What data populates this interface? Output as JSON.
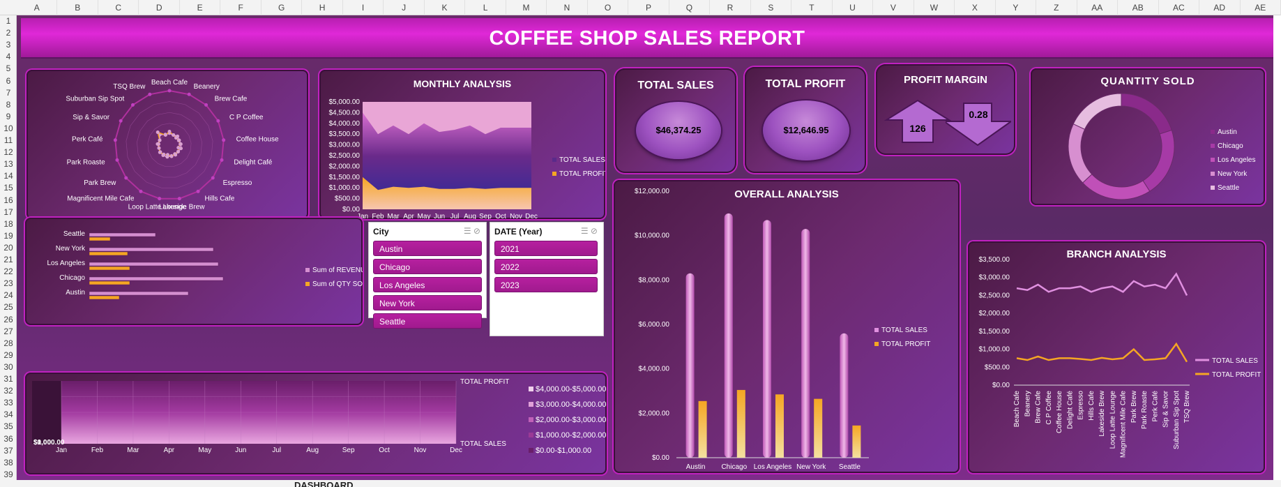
{
  "sheet": {
    "columns": [
      "A",
      "B",
      "C",
      "D",
      "E",
      "F",
      "G",
      "H",
      "I",
      "J",
      "K",
      "L",
      "M",
      "N",
      "O",
      "P",
      "Q",
      "R",
      "S",
      "T",
      "U",
      "V",
      "W",
      "X",
      "Y",
      "Z",
      "AA",
      "AB",
      "AC",
      "AD",
      "AE"
    ],
    "rows": [
      "1",
      "2",
      "3",
      "4",
      "5",
      "6",
      "7",
      "8",
      "9",
      "10",
      "11",
      "12",
      "13",
      "14",
      "15",
      "16",
      "17",
      "18",
      "19",
      "20",
      "21",
      "22",
      "23",
      "24",
      "25",
      "26",
      "27",
      "28",
      "29",
      "30",
      "31",
      "32",
      "33",
      "34",
      "35",
      "36",
      "37",
      "38",
      "39"
    ],
    "active_tab": "DASHBOARD"
  },
  "dashboard": {
    "title": "COFFEE SHOP SALES REPORT",
    "total_sales": {
      "title": "TOTAL SALES",
      "value": "$46,374.25"
    },
    "total_profit": {
      "title": "TOTAL PROFIT",
      "value": "$12,646.95"
    },
    "profit_margin": {
      "title": "PROFIT MARGIN",
      "up_value": "126",
      "down_value": "0.28"
    },
    "colors": {
      "sales_pink": "#e090e0",
      "profit_orange": "#f5a623",
      "accent_magenta": "#e028d8"
    }
  },
  "city_slicer": {
    "title": "City",
    "items": [
      "Austin",
      "Chicago",
      "Los Angeles",
      "New York",
      "Seattle"
    ]
  },
  "year_slicer": {
    "title": "DATE (Year)",
    "items": [
      "2021",
      "2022",
      "2023"
    ]
  },
  "chart_data": [
    {
      "id": "radar",
      "type": "radar",
      "categories": [
        "Beach Cafe",
        "Beanery",
        "Brew Cafe",
        "C P Coffee",
        "Coffee House",
        "Delight Café",
        "Espresso",
        "Hills Cafe",
        "Lakeside Brew",
        "Loop Latte Lounge",
        "Magnificent Mile Cafe",
        "Park Brew",
        "Park Roaste",
        "Perk Café",
        "Sip & Savor",
        "Suburban Sip Spot",
        "TSQ Brew"
      ],
      "series": [
        {
          "values": [
            0.22,
            0.2,
            0.22,
            0.2,
            0.21,
            0.22,
            0.2,
            0.21,
            0.2,
            0.22,
            0.22,
            0.21,
            0.2,
            0.22,
            0.2,
            0.26,
            0.21
          ]
        },
        {
          "values": [
            0.25,
            0.2,
            0.18,
            0.19,
            0.2,
            0.17,
            0.2,
            0.19,
            0.21,
            0.18,
            0.2,
            0.22,
            0.2,
            0.2,
            0.2,
            0.32,
            0.2
          ]
        }
      ]
    },
    {
      "id": "monthly",
      "type": "area",
      "title": "MONTHLY ANALYSIS",
      "categories": [
        "Jan",
        "Feb",
        "Mar",
        "Apr",
        "May",
        "Jun",
        "Jul",
        "Aug",
        "Sep",
        "Oct",
        "Nov",
        "Dec"
      ],
      "yticks": [
        "$0.00",
        "$500.00",
        "$1,000.00",
        "$1,500.00",
        "$2,000.00",
        "$2,500.00",
        "$3,000.00",
        "$3,500.00",
        "$4,000.00",
        "$4,500.00",
        "$5,000.00"
      ],
      "ylim": [
        0,
        5000
      ],
      "series": [
        {
          "name": "TOTAL SALES",
          "values": [
            4500,
            3500,
            3900,
            3500,
            4000,
            3600,
            3700,
            3900,
            3500,
            3800,
            3800,
            3800
          ]
        },
        {
          "name": "TOTAL PROFIT",
          "values": [
            1500,
            900,
            1050,
            1000,
            1050,
            950,
            950,
            1000,
            950,
            1000,
            1000,
            1000
          ]
        }
      ]
    },
    {
      "id": "quantity",
      "type": "pie",
      "title": "QUANTITY SOLD",
      "categories": [
        "Austin",
        "Chicago",
        "Los Angeles",
        "New York",
        "Seattle"
      ],
      "values": [
        20,
        21,
        22,
        19,
        18
      ]
    },
    {
      "id": "revenue_qty",
      "type": "bar",
      "categories": [
        "Seattle",
        "New York",
        "Los Angeles",
        "Chicago",
        "Austin"
      ],
      "series": [
        {
          "name": "Sum of REVENUE",
          "values": [
            95,
            178,
            185,
            192,
            142
          ]
        },
        {
          "name": "Sum of QTY SOLD",
          "values": [
            30,
            55,
            58,
            58,
            43
          ]
        }
      ]
    },
    {
      "id": "overall",
      "type": "bar",
      "title": "OVERALL ANALYSIS",
      "categories": [
        "Austin",
        "Chicago",
        "Los Angeles",
        "New York",
        "Seattle"
      ],
      "yticks": [
        "$0.00",
        "$2,000.00",
        "$4,000.00",
        "$6,000.00",
        "$8,000.00",
        "$10,000.00",
        "$12,000.00"
      ],
      "ylim": [
        0,
        12000
      ],
      "series": [
        {
          "name": "TOTAL SALES",
          "values": [
            8300,
            11000,
            10700,
            10300,
            5600
          ]
        },
        {
          "name": "TOTAL PROFIT",
          "values": [
            2550,
            3050,
            2850,
            2650,
            1450
          ]
        }
      ]
    },
    {
      "id": "branch",
      "type": "line",
      "title": "BRANCH ANALYSIS",
      "categories": [
        "Beach Cafe",
        "Beanery",
        "Brew Cafe",
        "C P Coffee",
        "Coffee House",
        "Delight Café",
        "Espresso",
        "Hills Cafe",
        "Lakeside Brew",
        "Loop Latte Lounge",
        "Magnificent Mile Cafe",
        "Park Brew",
        "Park Roaste",
        "Perk Café",
        "Sip & Savor",
        "Suburban Sip Spot",
        "TSQ Brew"
      ],
      "yticks": [
        "$0.00",
        "$500.00",
        "$1,000.00",
        "$1,500.00",
        "$2,000.00",
        "$2,500.00",
        "$3,000.00",
        "$3,500.00"
      ],
      "ylim": [
        0,
        3500
      ],
      "series": [
        {
          "name": "TOTAL SALES",
          "values": [
            2700,
            2650,
            2800,
            2600,
            2700,
            2700,
            2750,
            2600,
            2700,
            2750,
            2600,
            2900,
            2750,
            2800,
            2700,
            3100,
            2500
          ]
        },
        {
          "name": "TOTAL PROFIT",
          "values": [
            750,
            700,
            800,
            700,
            750,
            750,
            730,
            700,
            760,
            720,
            750,
            1000,
            700,
            720,
            750,
            1150,
            650
          ]
        }
      ]
    },
    {
      "id": "surface",
      "type": "area",
      "categories": [
        "Jan",
        "Feb",
        "Mar",
        "Apr",
        "May",
        "Jun",
        "Jul",
        "Aug",
        "Sep",
        "Oct",
        "Nov",
        "Dec"
      ],
      "ytick_first": "$0.00",
      "ytick_second": "$1,000.00",
      "series_axis": [
        "TOTAL PROFIT",
        "TOTAL SALES"
      ],
      "legend": [
        "$4,000.00-$5,000.00",
        "$3,000.00-$4,000.00",
        "$2,000.00-$3,000.00",
        "$1,000.00-$2,000.00",
        "$0.00-$1,000.00"
      ]
    }
  ]
}
